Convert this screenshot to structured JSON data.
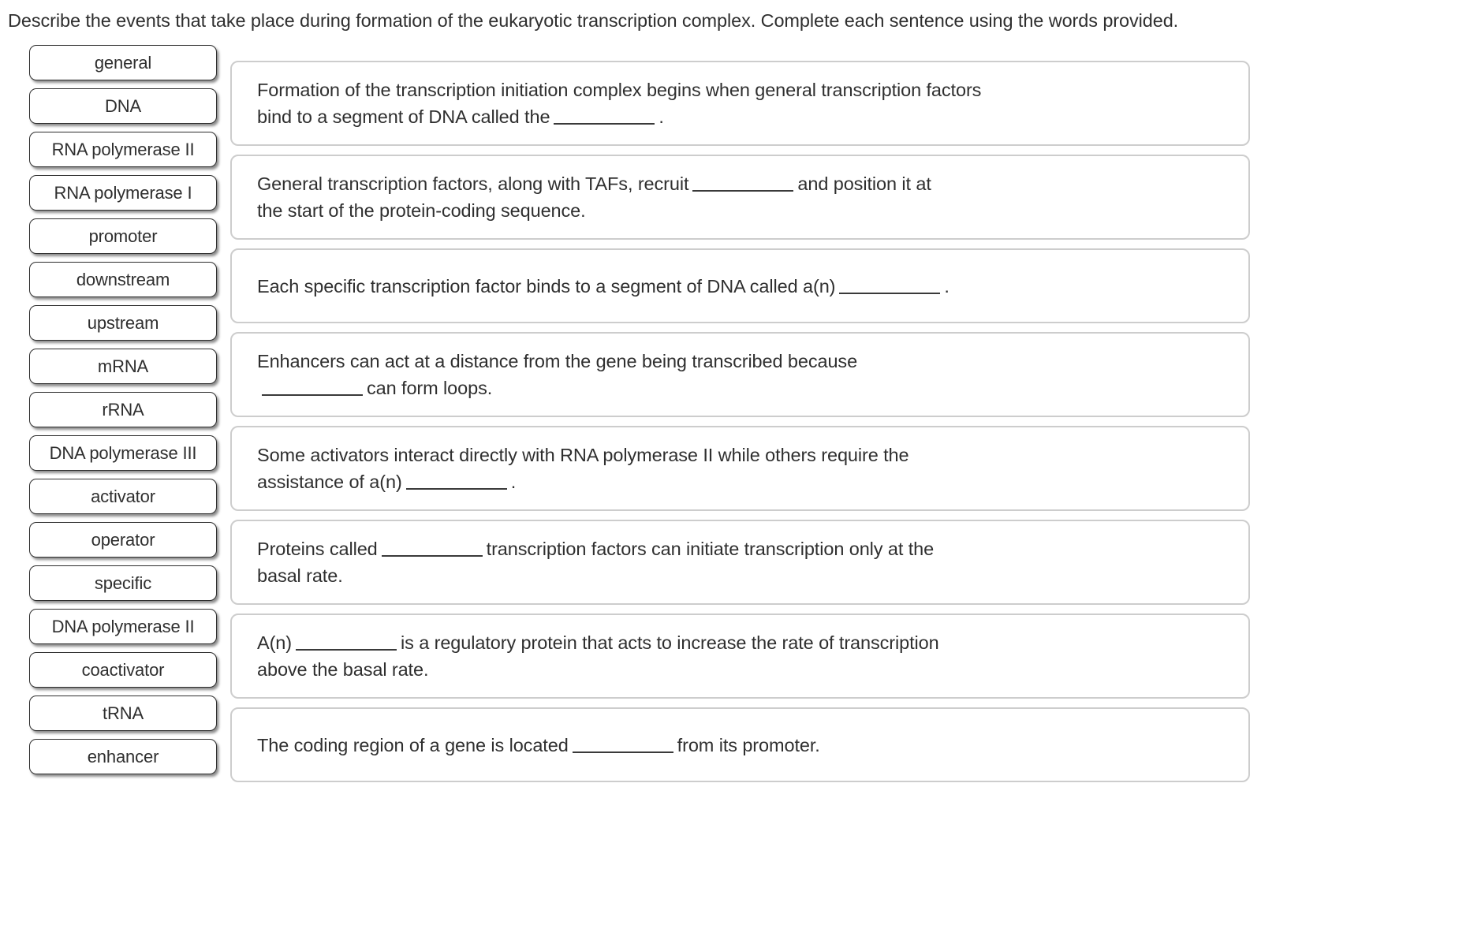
{
  "prompt": "Describe the events that take place during formation of the eukaryotic transcription complex. Complete each sentence using the words provided.",
  "colors": {
    "tile_border": "#2e2e2e",
    "card_border": "#cdcdcd",
    "text": "#2f2f2f",
    "page_background": "#ffffff"
  },
  "word_bank": {
    "items": [
      {
        "label": "general"
      },
      {
        "label": "DNA"
      },
      {
        "label": "RNA polymerase II"
      },
      {
        "label": "RNA polymerase I"
      },
      {
        "label": "promoter"
      },
      {
        "label": "downstream"
      },
      {
        "label": "upstream"
      },
      {
        "label": "mRNA"
      },
      {
        "label": "rRNA"
      },
      {
        "label": "DNA polymerase III"
      },
      {
        "label": "activator"
      },
      {
        "label": "operator"
      },
      {
        "label": "specific"
      },
      {
        "label": "DNA polymerase II"
      },
      {
        "label": "coactivator"
      },
      {
        "label": "tRNA"
      },
      {
        "label": "enhancer"
      }
    ]
  },
  "sentences": [
    {
      "line1_pre": "Formation of the transcription initiation complex begins when general transcription factors",
      "line2_pre": "bind to a segment of DNA called the",
      "line2_post": "."
    },
    {
      "line1_pre": "General transcription factors, along with TAFs, recruit",
      "line1_post": "and position it at",
      "line2_pre": "the start of the protein-coding sequence."
    },
    {
      "line1_pre": "Each specific transcription factor binds to a segment of DNA called a(n)",
      "line1_post": "."
    },
    {
      "line1_pre": "Enhancers can act at a distance from the gene being transcribed because",
      "line2_post": "can form loops."
    },
    {
      "line1_pre": "Some activators interact directly with RNA polymerase II while others require the",
      "line2_pre": "assistance of a(n)",
      "line2_post": "."
    },
    {
      "line1_pre": "Proteins called",
      "line1_post": "transcription factors can initiate transcription only at the",
      "line2_pre": "basal rate."
    },
    {
      "line1_pre": "A(n)",
      "line1_post": "is a regulatory protein that acts to increase the rate of transcription",
      "line2_pre": "above the basal rate."
    },
    {
      "line1_pre": "The coding region of a gene is located",
      "line1_post": "from its promoter."
    }
  ]
}
